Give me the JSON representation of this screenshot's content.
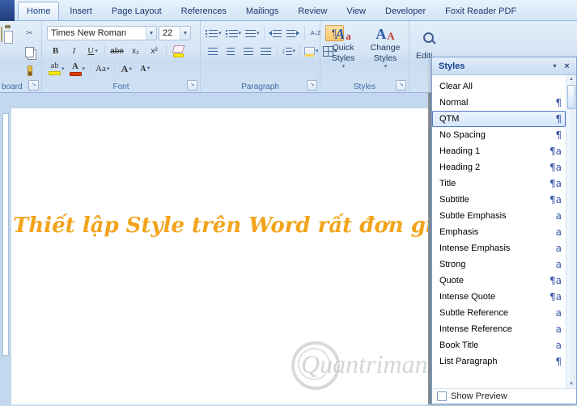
{
  "ribbon": {
    "tabs": [
      {
        "label": "Home",
        "active": true
      },
      {
        "label": "Insert",
        "active": false
      },
      {
        "label": "Page Layout",
        "active": false
      },
      {
        "label": "References",
        "active": false
      },
      {
        "label": "Mailings",
        "active": false
      },
      {
        "label": "Review",
        "active": false
      },
      {
        "label": "View",
        "active": false
      },
      {
        "label": "Developer",
        "active": false
      },
      {
        "label": "Foxit Reader PDF",
        "active": false
      }
    ],
    "clipboard": {
      "label": "board"
    },
    "font": {
      "label": "Font",
      "name": "Times New Roman",
      "size": "22",
      "bold": "B",
      "italic": "I",
      "underline": "U",
      "strikethrough": "abe",
      "subscript": "x₂",
      "superscript": "x²",
      "highlight": "ab",
      "color_letter": "A",
      "change_case": "Aa",
      "grow": "A",
      "shrink": "A"
    },
    "paragraph": {
      "label": "Paragraph",
      "sort": "A↓Z",
      "pilcrow": "¶"
    },
    "styles": {
      "label": "Styles",
      "quick": "Quick Styles",
      "change": "Change Styles"
    },
    "editing": {
      "label": "Editi"
    }
  },
  "document": {
    "heading": "Thiết lập Style trên Word rất đơn giản",
    "watermark": "Quantrimang"
  },
  "styles_pane": {
    "title": "Styles",
    "items": [
      {
        "label": "Clear All",
        "symbol": ""
      },
      {
        "label": "Normal",
        "symbol": "¶"
      },
      {
        "label": "QTM",
        "symbol": "¶",
        "selected": true
      },
      {
        "label": "No Spacing",
        "symbol": "¶"
      },
      {
        "label": "Heading 1",
        "symbol": "¶a"
      },
      {
        "label": "Heading 2",
        "symbol": "¶a"
      },
      {
        "label": "Title",
        "symbol": "¶a"
      },
      {
        "label": "Subtitle",
        "symbol": "¶a"
      },
      {
        "label": "Subtle Emphasis",
        "symbol": "a"
      },
      {
        "label": "Emphasis",
        "symbol": "a"
      },
      {
        "label": "Intense Emphasis",
        "symbol": "a"
      },
      {
        "label": "Strong",
        "symbol": "a"
      },
      {
        "label": "Quote",
        "symbol": "¶a"
      },
      {
        "label": "Intense Quote",
        "symbol": "¶a"
      },
      {
        "label": "Subtle Reference",
        "symbol": "a"
      },
      {
        "label": "Intense Reference",
        "symbol": "a"
      },
      {
        "label": "Book Title",
        "symbol": "a"
      },
      {
        "label": "List Paragraph",
        "symbol": "¶"
      }
    ],
    "footer": {
      "show_preview": "Show Preview"
    }
  },
  "colors": {
    "heading_orange": "#F2A41C",
    "style_symbol_blue": "#3A57A7",
    "selection_border": "#4F7CC2",
    "highlight_yellow": "#FFE900",
    "font_color_red": "#E03A00"
  }
}
